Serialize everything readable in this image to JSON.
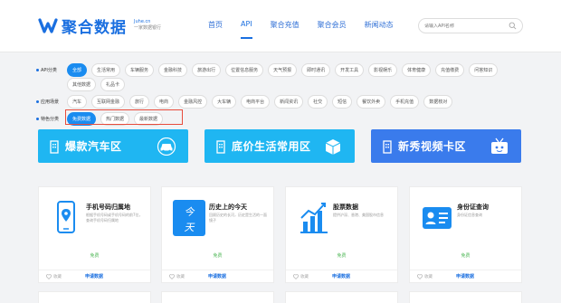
{
  "logo": {
    "text": "聚合数据",
    "domain": "Juhe.cn",
    "tagline": "一家数据银行",
    "brand_color": "#1a6fe0"
  },
  "nav": [
    {
      "label": "首页",
      "active": false
    },
    {
      "label": "API",
      "active": true
    },
    {
      "label": "聚合充值",
      "active": false
    },
    {
      "label": "聚合会员",
      "active": false
    },
    {
      "label": "新闻动态",
      "active": false
    }
  ],
  "search": {
    "placeholder": "请输入API名称"
  },
  "filters": {
    "category": {
      "label": "API分类",
      "items": [
        "全部",
        "生活常用",
        "车辆服务",
        "金融科技",
        "旅游出行",
        "位置信息服务",
        "天气预报",
        "即时通讯",
        "开发工具",
        "影视娱乐",
        "体育健康",
        "充值缴费",
        "问答知识",
        "其他数据",
        "礼品卡"
      ],
      "selected": "全部"
    },
    "scene": {
      "label": "应用场景",
      "items": [
        "汽车",
        "互联网金融",
        "旅行",
        "电商",
        "金融风控",
        "大车辆",
        "电商平台",
        "新闻资讯",
        "社交",
        "短信",
        "餐饮外卖",
        "手机充值",
        "数据核对"
      ]
    },
    "feature": {
      "label": "特色分类",
      "items": [
        "免费数据",
        "热门数据",
        "最新数据"
      ],
      "selected": "免费数据"
    }
  },
  "banners": [
    {
      "label": "爆款汽车区",
      "icon": "car-icon",
      "color": "#1fb6f2"
    },
    {
      "label": "底价生活常用区",
      "icon": "package-icon",
      "color": "#1fb6f2"
    },
    {
      "label": "新秀视频卡区",
      "icon": "tv-icon",
      "color": "#3a7bec"
    }
  ],
  "cards": [
    {
      "title": "手机号码归属地",
      "desc": "根据手机号码或手机号码的前7位，查询手机号码归属地",
      "price": "免费",
      "fav": "收藏",
      "apply": "申请数据",
      "icon": "phone-location-icon"
    },
    {
      "title": "历史上的今天",
      "desc": "回顾历史的长河，历史是生活的一面镜子",
      "price": "免费",
      "fav": "收藏",
      "apply": "申请数据",
      "icon": "history-today-icon"
    },
    {
      "title": "股票数据",
      "desc": "提供沪深、香港、美国股市信息",
      "price": "免费",
      "fav": "收藏",
      "apply": "申请数据",
      "icon": "stock-chart-icon"
    },
    {
      "title": "身份证查询",
      "desc": "身份证信息查询",
      "price": "免费",
      "fav": "收藏",
      "apply": "申请数据",
      "icon": "id-card-icon"
    }
  ]
}
